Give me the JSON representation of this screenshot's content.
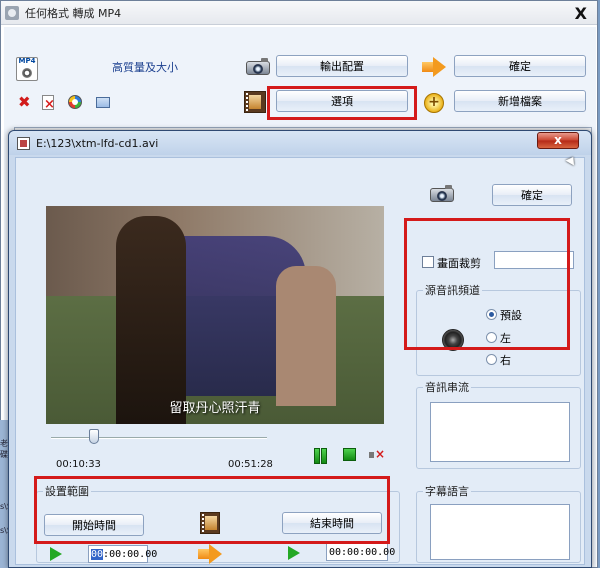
{
  "main_window": {
    "title": "任何格式 轉成 MP4",
    "close_glyph": "X",
    "logo_text": "MP4",
    "quality_label": "高質量及大小",
    "buttons": {
      "output_config": "輸出配置",
      "confirm": "確定",
      "options": "選項",
      "add_file": "新增檔案"
    }
  },
  "dialog": {
    "title": "E:\\123\\xtm-lfd-cd1.avi",
    "close_glyph": "x",
    "confirm_button": "確定",
    "video": {
      "subtitle_text": "留取丹心照汗青",
      "current_time": "00:10:33",
      "total_time": "00:51:28",
      "progress": 0.2
    },
    "crop": {
      "label": "畫面裁剪",
      "checked": false,
      "value": ""
    },
    "audio_channel": {
      "legend": "源音訊頻道",
      "options": [
        "預設",
        "左",
        "右"
      ],
      "selected": 0
    },
    "audio_stream_legend": "音訊串流",
    "subtitle_lang_legend": "字幕語言",
    "range": {
      "legend": "設置範圍",
      "start_button": "開始時間",
      "end_button": "結束時間",
      "start_value_cursor": "00",
      "start_value_rest": ":00:00.00",
      "end_value": "00:00:00.00"
    }
  },
  "edge_texts": [
    "老碟",
    "s\\So",
    "s\\So"
  ],
  "colors": {
    "highlight": "#d41a1a",
    "dialog_bg": "#e3ecf7",
    "accent_blue": "#1b3f8f"
  }
}
